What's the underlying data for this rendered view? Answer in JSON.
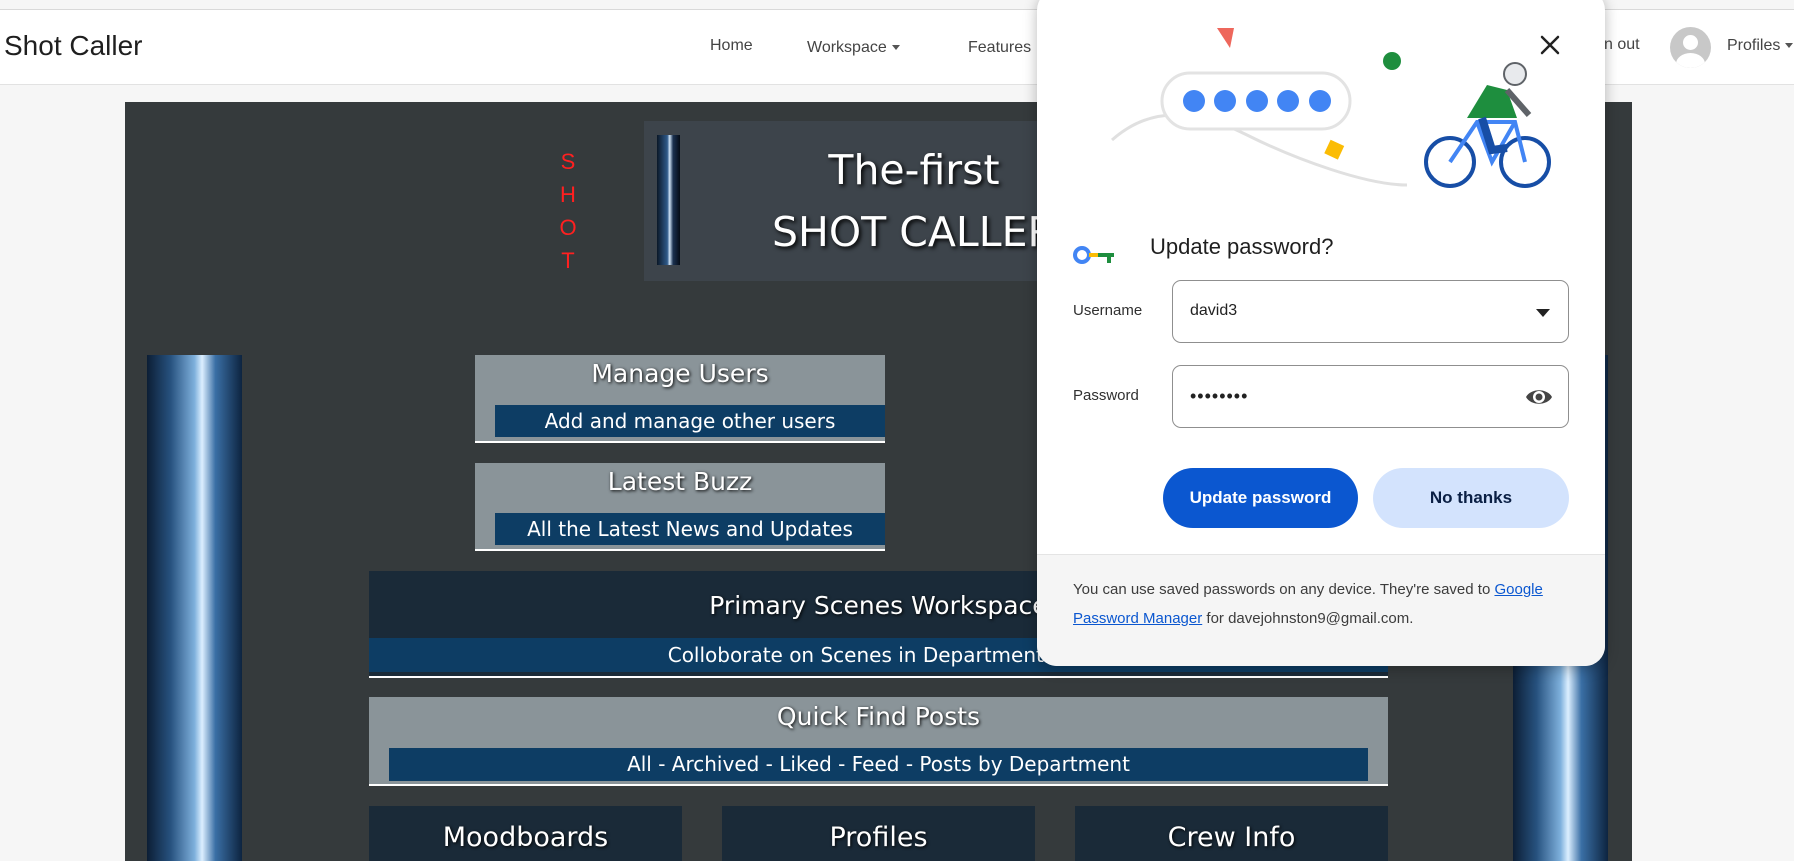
{
  "navbar": {
    "brand": "Shot Caller",
    "home": "Home",
    "workspace": "Workspace",
    "features": "Features",
    "signout": "n out",
    "profiles": "Profiles"
  },
  "hero": {
    "shot_letters": [
      "S",
      "H",
      "O",
      "T"
    ],
    "title_line1": "The-first",
    "title_line2": "SHOT CALLER"
  },
  "cards": {
    "manage_users": {
      "title": "Manage Users",
      "sub": "Add and manage other users"
    },
    "latest_buzz": {
      "title": "Latest Buzz",
      "sub": "All the Latest News and Updates"
    },
    "primary_scenes": {
      "title": "Primary Scenes Workspace",
      "sub": "Colloborate on Scenes in Department Wor"
    },
    "quick_find": {
      "title": "Quick Find Posts",
      "sub": "All - Archived - Liked - Feed - Posts by Department"
    }
  },
  "tiles": [
    "Moodboards",
    "Profiles",
    "Crew Info"
  ],
  "popup": {
    "title": "Update password?",
    "username_label": "Username",
    "username_value": "david3",
    "password_label": "Password",
    "password_value": "••••••••",
    "update_button": "Update password",
    "no_thanks_button": "No thanks",
    "footer_text_1": "You can use saved passwords on any device. They're saved to ",
    "footer_link": "Google Password Manager",
    "footer_text_2": " for davejohnston9@gmail.com."
  },
  "colors": {
    "accent": "#0b57d0",
    "secondary_button": "#d3e3fd",
    "panel_bg": "#353a3c",
    "card_gray": "#8a9499",
    "card_sub": "#0d3d64",
    "shot_red": "#ff2020"
  }
}
